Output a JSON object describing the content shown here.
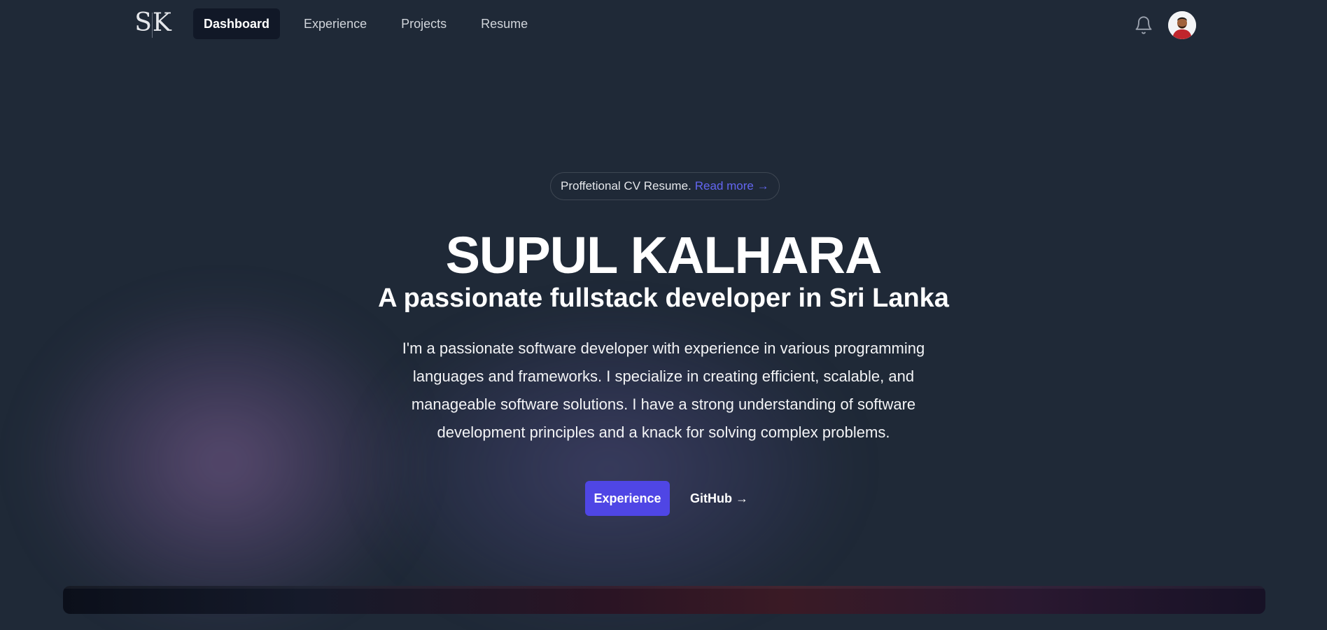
{
  "nav": {
    "logo_text": "SK",
    "links": [
      {
        "label": "Dashboard",
        "active": true
      },
      {
        "label": "Experience",
        "active": false
      },
      {
        "label": "Projects",
        "active": false
      },
      {
        "label": "Resume",
        "active": false
      }
    ],
    "bell_icon": "bell-icon",
    "avatar_icon": "user-avatar"
  },
  "hero": {
    "pill_text": "Proffetional CV Resume.",
    "pill_link": "Read more →",
    "title": "SUPUL KALHARA",
    "subtitle": "A passionate fullstack developer in Sri Lanka",
    "description": "I'm a passionate software developer with experience in various programming languages and frameworks. I specialize in creating efficient, scalable, and manageable software solutions. I have a strong understanding of software development principles and a knack for solving complex problems.",
    "primary_button": "Experience",
    "secondary_link": "GitHub →"
  },
  "colors": {
    "background": "#1f2937",
    "accent": "#4f46e5",
    "link": "#6366f1",
    "active_nav": "#111827"
  }
}
